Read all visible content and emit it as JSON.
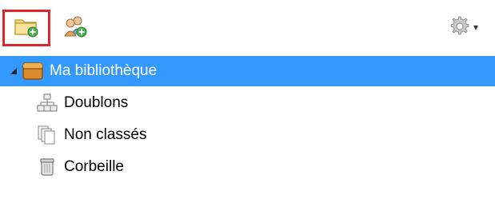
{
  "toolbar": {
    "buttons": [
      {
        "name": "new-collection",
        "icon": "folder-add-icon",
        "highlighted": true
      },
      {
        "name": "new-group",
        "icon": "group-add-icon"
      },
      {
        "name": "actions-menu",
        "icon": "gear-icon",
        "has_dropdown": true
      }
    ]
  },
  "tree": {
    "library": {
      "label": "Ma bibliothèque",
      "icon": "library-icon",
      "expanded": true,
      "selected": true
    },
    "items": [
      {
        "label": "Doublons",
        "icon": "duplicates-icon"
      },
      {
        "label": "Non classés",
        "icon": "unfiled-icon"
      },
      {
        "label": "Corbeille",
        "icon": "trash-icon"
      }
    ]
  },
  "colors": {
    "selection": "#3399ff",
    "highlight_border": "#e0242b"
  }
}
